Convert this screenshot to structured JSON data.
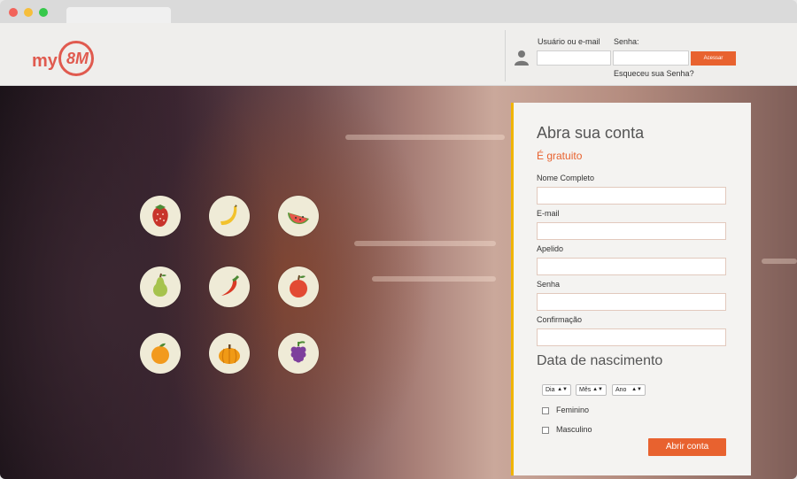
{
  "header": {
    "logo_text": "my",
    "logo_mark": "8M",
    "username_label": "Usuário ou e-mail",
    "password_label": "Senha:",
    "login_button": "Acessar",
    "forgot_link": "Esqueceu sua Senha?"
  },
  "signup": {
    "title": "Abra sua conta",
    "subtitle": "É gratuito",
    "fields": [
      {
        "label": "Nome Completo"
      },
      {
        "label": "E-mail"
      },
      {
        "label": "Apelido"
      },
      {
        "label": "Senha"
      },
      {
        "label": "Confirmação"
      }
    ],
    "dob_title": "Data de nascimento",
    "dob_day": "Dia",
    "dob_month": "Mês",
    "dob_year": "Ano",
    "gender_female": "Feminino",
    "gender_male": "Masculino",
    "submit": "Abrir conta"
  },
  "fruits": [
    "strawberry-icon",
    "banana-icon",
    "watermelon-icon",
    "pear-icon",
    "chili-pepper-icon",
    "apple-icon",
    "orange-icon",
    "pumpkin-icon",
    "grapes-icon"
  ],
  "colors": {
    "accent": "#e8622f",
    "logo": "#e05a4f",
    "card_border": "#f0b400"
  }
}
